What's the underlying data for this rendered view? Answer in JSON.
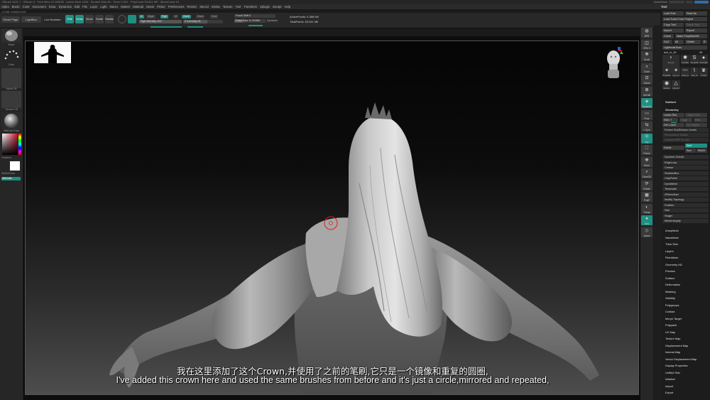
{
  "titlebar": {
    "text": "ZBrush 2021.7 · ZBrush 3 · Free Mem 12.535GB · Active Mem 1409 · Scratch Disk 89 · Timer 0.031 · PolyCount 53.811 MP · MeshCount 16",
    "quicksave": "QuickSave",
    "default_zscript": "DefaultZScript"
  },
  "menu": [
    "Alpha",
    "Brush",
    "Color",
    "Document",
    "Draw",
    "Dynamics",
    "Edit",
    "File",
    "Layer",
    "Light",
    "Macro",
    "Marker",
    "Material",
    "Movie",
    "Picker",
    "Preferences",
    "Render",
    "Stencil",
    "Stroke",
    "Texture",
    "Tool",
    "Transform",
    "Zplugin",
    "Zscript",
    "Help"
  ],
  "tool_title": "Tool",
  "coords": "-0.195,-0.645,0.047",
  "shelf": {
    "home_page": "Home Page",
    "lightbox": "LightBox",
    "live_boolean": "Live Boolean",
    "edit": "Edit",
    "draw": "Draw",
    "move": "Move",
    "scale": "Scale",
    "rotate": "Rotate",
    "mrgb": "Mrgb",
    "rgb": "Rgb",
    "m": "M",
    "zsub": "Zsub",
    "zadd": "Zadd",
    "zcut": "Zcut",
    "rgb_intensity": "Rgb Intensity 100",
    "z_intensity": "Z Intensity 61",
    "focal_shift": "Focal Shift 0",
    "draw_size": "Draw Size 11.90465",
    "dynamic": "Dynamic",
    "active_points": "ActivePoints: 5.388 Mil",
    "total_points": "TotalPoints: 53.811 Mil"
  },
  "left_shelf": {
    "brush_label": "Move",
    "stroke_label": "Dots",
    "alpha_label": "Alpha Off",
    "texture_label": "Texture Off",
    "material_label": "MatCap Gray",
    "gradient": "Gradient",
    "switch_color": "SwitchColor",
    "alternate": "Alternate"
  },
  "subtitles": {
    "cn": "我在这里添加了这个Crown,并使用了之前的笔刷,它只是一个镜像和重复的圆圈,",
    "en": "I've added this crown here and used the same brushes from before and it's just a circle,mirrored and repeated,"
  },
  "right_shelf": [
    "BPR",
    "SPix 3",
    "Scroll",
    "Zoom",
    "Actual",
    "AAHalf",
    "Dynamic Persp",
    "Floor",
    "L.Sym",
    "Xyz",
    "Frame",
    "Move",
    "Zoom3D",
    "Rotate",
    "PolyF",
    "Transp",
    "Solo",
    "Xpose"
  ],
  "tool_panel": {
    "load_tool": "Load Tool",
    "save_as": "Save As",
    "load_from_project": "Load Tools From Project",
    "copy_tool": "Copy Tool",
    "paste_tool": "Paste Tool",
    "import": "Import",
    "export": "Export",
    "clone": "Clone",
    "make_polymesh": "Make PolyMesh3D",
    "goz": "GoZ",
    "all": "All",
    "visible": "Visible",
    "r": "R",
    "lightbox_tools": "Lightbox▸Tools",
    "tool_name": "tool_lo_49",
    "tool_count": "49",
    "tools": [
      {
        "label": "tool_lo",
        "icon": "figure-icon"
      },
      {
        "label": "PolyMe",
        "icon": "polymesh-icon"
      },
      {
        "label": "SimpleB",
        "icon": "simplebrush-icon"
      },
      {
        "label": "PolySphe",
        "icon": "polysphere-icon"
      },
      {
        "label": "PolyMes",
        "icon": "star-icon"
      },
      {
        "label": "eye_lo",
        "icon": "star-icon"
      },
      {
        "label": "claw_lo",
        "icon": "claw-icon"
      },
      {
        "label": "hair_lo",
        "icon": "hair-icon"
      },
      {
        "label": "Crown",
        "icon": "crown-icon"
      },
      {
        "label": "Marker",
        "icon": "marker-icon"
      },
      {
        "label": "Hipoint",
        "icon": "hipoint-icon"
      }
    ],
    "subtool": "Subtool",
    "geometry": "Geometry",
    "lower_res": "Lower Res",
    "higher_res": "Higher Res",
    "sdiv": "SDiv 7",
    "cage": "Cage",
    "rstr": "Rstr",
    "del_lower": "Del Lower",
    "del_higher": "Del Higher",
    "freeze_subdiv": "Freeze SubDivision Levels",
    "reconstruct_subdiv": "Reconstruct Subdiv",
    "convert_bpr": "Convert BPR To Geo",
    "divide": "Divide",
    "smt": "Smt",
    "suv": "Suv",
    "reuv": "ReUV",
    "geometry_items": [
      "Dynamic Subdiv",
      "EdgeLoop",
      "Crease",
      "ShadowBox",
      "ClayPolish",
      "DynaMesh",
      "Tessimate",
      "ZRemesher",
      "Modify Topology",
      "Position",
      "Size",
      "Stager",
      "MeshIntegrity"
    ],
    "sections": [
      "ArrayMesh",
      "NanoMesh",
      "Thick Skin",
      "Layers",
      "FiberMesh",
      "Geometry HD",
      "Preview",
      "Surface",
      "Deformation",
      "Masking",
      "Visibility",
      "Polygroups",
      "Contact",
      "Morph Target",
      "Polypaint",
      "UV Map",
      "Texture Map",
      "Displacement Map",
      "Normal Map",
      "Vector Displacement Map",
      "Display Properties",
      "Unified Skin",
      "Initialize",
      "Import",
      "Export"
    ]
  },
  "colors": {
    "teal": "#1f8f82",
    "panel": "#262626",
    "accent_red": "#e02020",
    "accent_green": "#2ecc40",
    "accent_blue": "#2060e0"
  }
}
